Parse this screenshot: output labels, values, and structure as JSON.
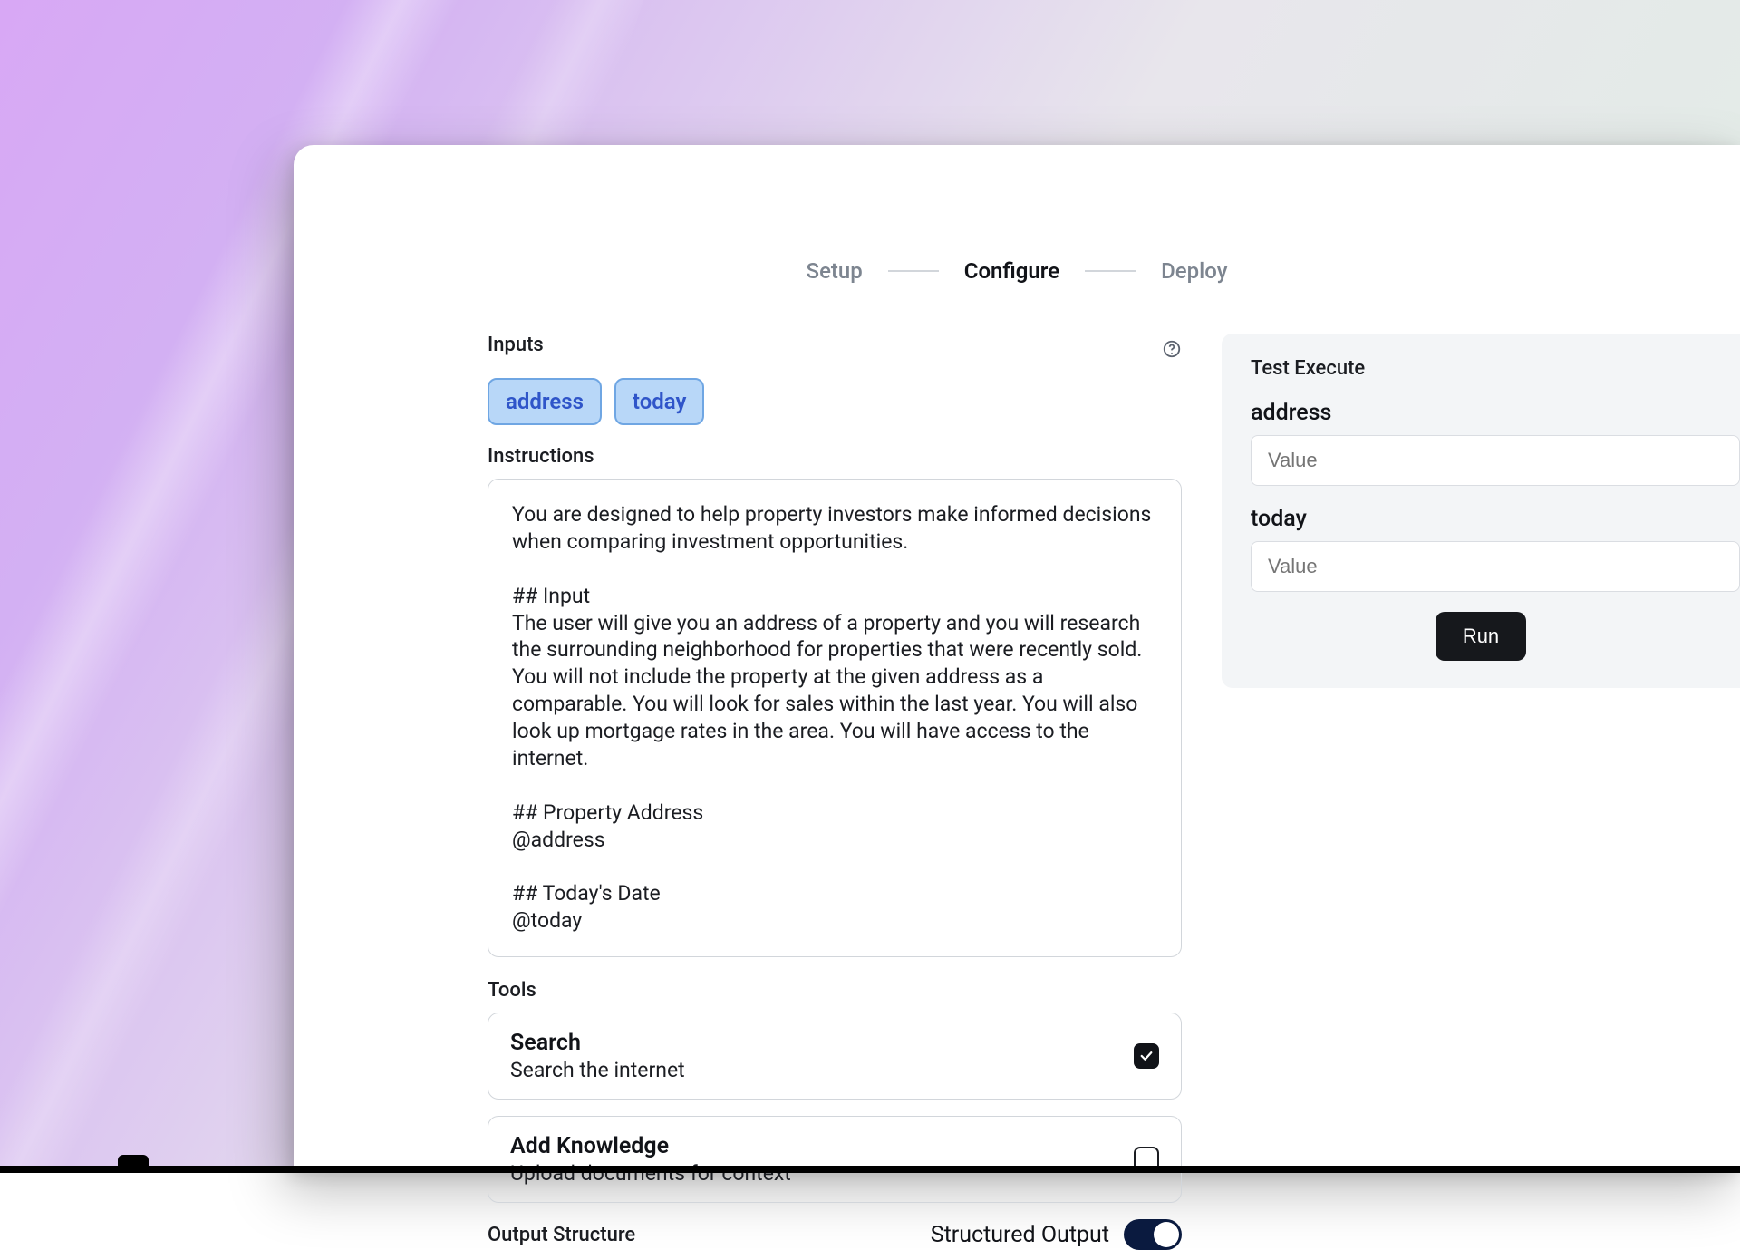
{
  "steps": {
    "setup": "Setup",
    "configure": "Configure",
    "deploy": "Deploy"
  },
  "inputs": {
    "label": "Inputs",
    "chips": [
      "address",
      "today"
    ]
  },
  "instructions": {
    "label": "Instructions",
    "text": "You are designed to help property investors make informed decisions when comparing investment opportunities.\n\n## Input\nThe user will give you an address of a property and you will research the surrounding neighborhood for properties that were recently sold. You will not include the property at the given address as a comparable. You will look for sales within the last year. You will also look up mortgage rates in the area. You will have access to the internet.\n\n## Property Address\n@address\n\n## Today's Date\n@today"
  },
  "tools": {
    "label": "Tools",
    "items": [
      {
        "title": "Search",
        "desc": "Search the internet",
        "checked": true
      },
      {
        "title": "Add Knowledge",
        "desc": "Upload documents for context",
        "checked": false
      }
    ]
  },
  "output": {
    "label": "Output Structure",
    "structured_label": "Structured Output",
    "enabled": true
  },
  "testExecute": {
    "title": "Test Execute",
    "fields": [
      {
        "label": "address",
        "placeholder": "Value"
      },
      {
        "label": "today",
        "placeholder": "Value"
      }
    ],
    "run": "Run"
  }
}
